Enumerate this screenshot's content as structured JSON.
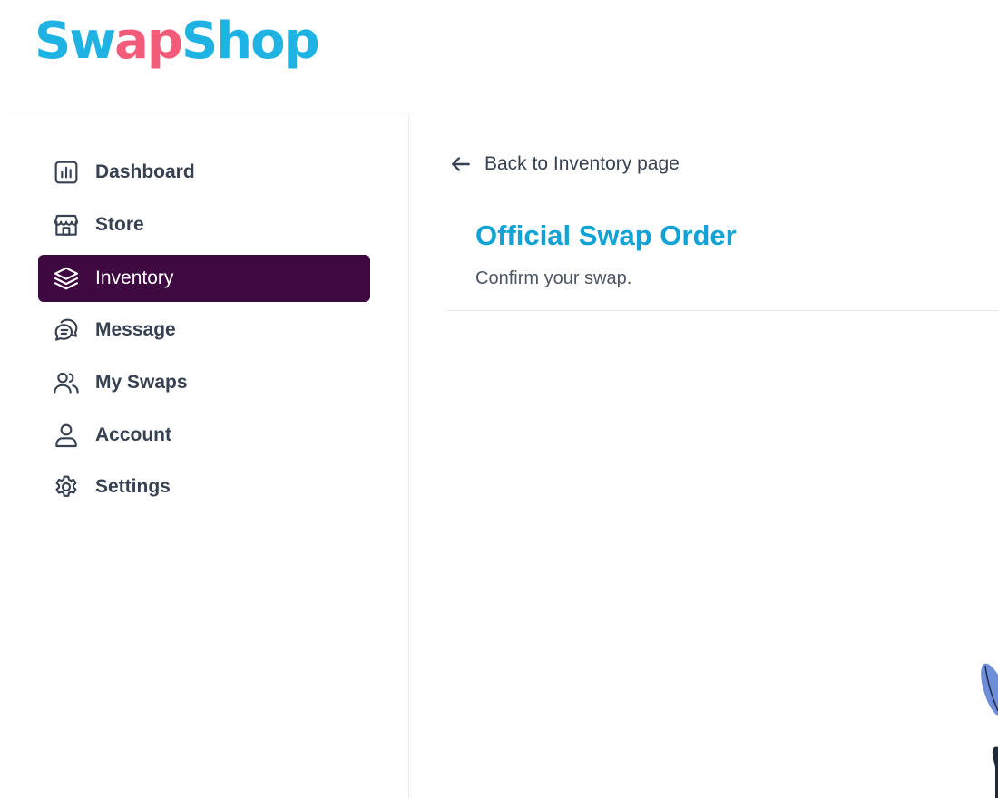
{
  "header": {
    "logo": {
      "part1": "Sw",
      "mark": "ap",
      "part2": "Shop"
    }
  },
  "sidebar": {
    "items": [
      {
        "label": "Dashboard",
        "icon": "bar-chart-icon",
        "active": false
      },
      {
        "label": "Store",
        "icon": "storefront-icon",
        "active": false
      },
      {
        "label": "Inventory",
        "icon": "layers-icon",
        "active": true
      },
      {
        "label": "Message",
        "icon": "chat-bubbles-icon",
        "active": false
      },
      {
        "label": "My Swaps",
        "icon": "users-icon",
        "active": false
      },
      {
        "label": "Account",
        "icon": "user-icon",
        "active": false
      },
      {
        "label": "Settings",
        "icon": "gear-icon",
        "active": false
      }
    ]
  },
  "main": {
    "back_link": "Back to Inventory page",
    "title": "Official Swap Order",
    "subtitle": "Confirm your swap."
  },
  "colors": {
    "logo_blue": "#1fb3e3",
    "logo_pink": "#f25c7a",
    "active_nav_bg": "#3d0940",
    "title_blue": "#12a3d6",
    "text": "#374151"
  }
}
